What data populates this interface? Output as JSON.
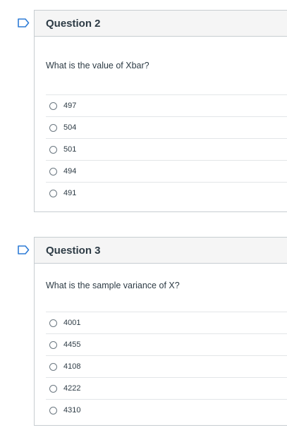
{
  "questions": [
    {
      "title": "Question 2",
      "text": "What is the value of Xbar?",
      "options": [
        "497",
        "504",
        "501",
        "494",
        "491"
      ]
    },
    {
      "title": "Question 3",
      "text": "What is the sample variance of X?",
      "options": [
        "4001",
        "4455",
        "4108",
        "4222",
        "4310"
      ]
    }
  ],
  "colors": {
    "flag": "#2d7bd6",
    "border": "#c7cdd1",
    "header_bg": "#f5f5f5"
  },
  "icons": {
    "flag": "bookmark-flag-icon",
    "radio": "radio-circle-icon"
  }
}
